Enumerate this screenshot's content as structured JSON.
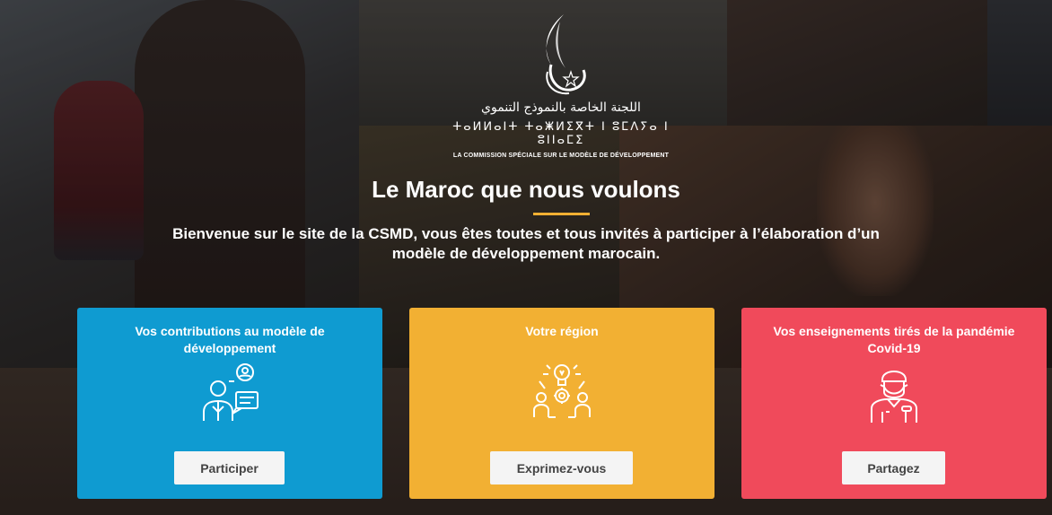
{
  "header": {
    "logo_arabic": "اللجنة الخاصة بالنموذج التنموي",
    "logo_tifinagh": "ⵜⴰⵍⵍⴰⵏⵜ ⵜⴰⵥⵍⵉⴳⵜ ⵏ ⵓⵎⴷⵢⴰ ⵏ ⵓⵏⵏⴰⵎⵉ",
    "logo_french": "LA COMMISSION SPÉCIALE SUR LE MODÈLE DE DÉVELOPPEMENT",
    "title": "Le Maroc que nous voulons",
    "subtitle": "Bienvenue sur le site de la CSMD, vous êtes toutes et tous invités à participer à l’élaboration d’un modèle de développement marocain."
  },
  "cards": [
    {
      "title": "Vos contributions au modèle de développement",
      "button": "Participer",
      "icon": "people-chat-icon",
      "color": "#0f9bd1"
    },
    {
      "title": "Votre région",
      "button": "Exprimez-vous",
      "icon": "idea-meeting-icon",
      "color": "#f2b033"
    },
    {
      "title": "Vos enseignements tirés de la pandémie Covid-19",
      "button": "Partagez",
      "icon": "masked-worker-icon",
      "color": "#f04a5b"
    }
  ],
  "colors": {
    "accent": "#f2b033"
  }
}
